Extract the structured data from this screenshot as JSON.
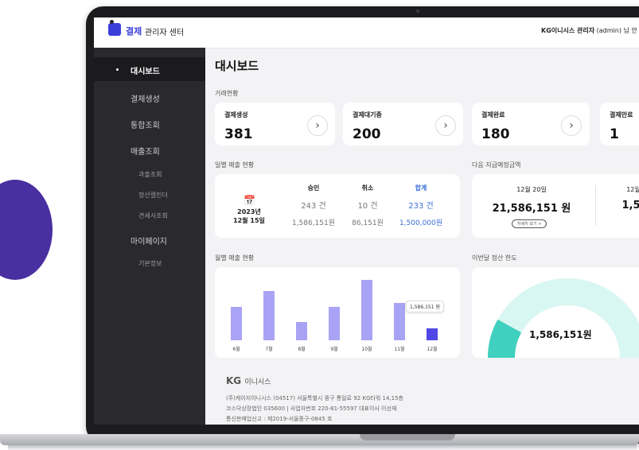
{
  "brand": {
    "logo_text": "결제",
    "center_label": "관리자 센터"
  },
  "header": {
    "company": "KG이니시스 관리자",
    "user": "(admin) 님 안"
  },
  "sidebar": {
    "items": [
      {
        "label": "대시보드"
      },
      {
        "label": "결제생성"
      },
      {
        "label": "통합조회"
      },
      {
        "label": "매출조회"
      },
      {
        "label": "마이페이지"
      }
    ],
    "subitems": [
      "과출조회",
      "정산캘린더",
      "견세서조회",
      "기본정보"
    ]
  },
  "page": {
    "title": "대시보드"
  },
  "transactions": {
    "label": "거래현황",
    "cards": [
      {
        "title": "결제생성",
        "value": "381"
      },
      {
        "title": "결제대기중",
        "value": "200"
      },
      {
        "title": "결제완료",
        "value": "180"
      },
      {
        "title": "결제만료",
        "value": "1"
      }
    ]
  },
  "daily": {
    "label": "일별 매출 현황",
    "date_year": "2023년",
    "date_day": "12월 15일",
    "columns": [
      {
        "header": "승인",
        "count": "243 건",
        "amount": "1,586,151원"
      },
      {
        "header": "취소",
        "count": "10 건",
        "amount": "86,151원"
      },
      {
        "header": "합계",
        "count": "233 건",
        "amount": "1,500,000원"
      }
    ]
  },
  "next_payment": {
    "label": "다음 지급예정금액",
    "items": [
      {
        "date": "12월 20일",
        "amount": "21,586,151 원",
        "button": "자세히 보기 >"
      },
      {
        "date": "12월",
        "amount": "1,5"
      }
    ]
  },
  "monthly": {
    "label": "월별 매출 현황",
    "tooltip": "1,586,151 원",
    "colors": {
      "bar": "#a9a3f5",
      "current": "#5047e6"
    },
    "chart_data": {
      "type": "bar",
      "categories": [
        "6월",
        "7월",
        "8월",
        "9월",
        "10월",
        "11월",
        "12월"
      ],
      "values": [
        0.55,
        0.82,
        0.3,
        0.55,
        1.0,
        0.62,
        0.2
      ]
    }
  },
  "limit": {
    "label": "이번달 정산 한도",
    "value": "1,586,151원",
    "gauge_fraction": 0.16,
    "colors": {
      "fill": "#3fd0bf",
      "track": "#d9f7f2"
    }
  },
  "footer": {
    "logo": "KG",
    "logo_sub": "이니시스",
    "line1": "(주)케이지이니시스 (04517) 서울특별시 중구 통일로 92 KG타워 14,15층",
    "line2": "코스닥상장법인 035600 | 사업자번호 220-81-55597 대표이사 이선재",
    "line3": "통신판매업신고 : 제2019-서울중구-0845 호"
  }
}
